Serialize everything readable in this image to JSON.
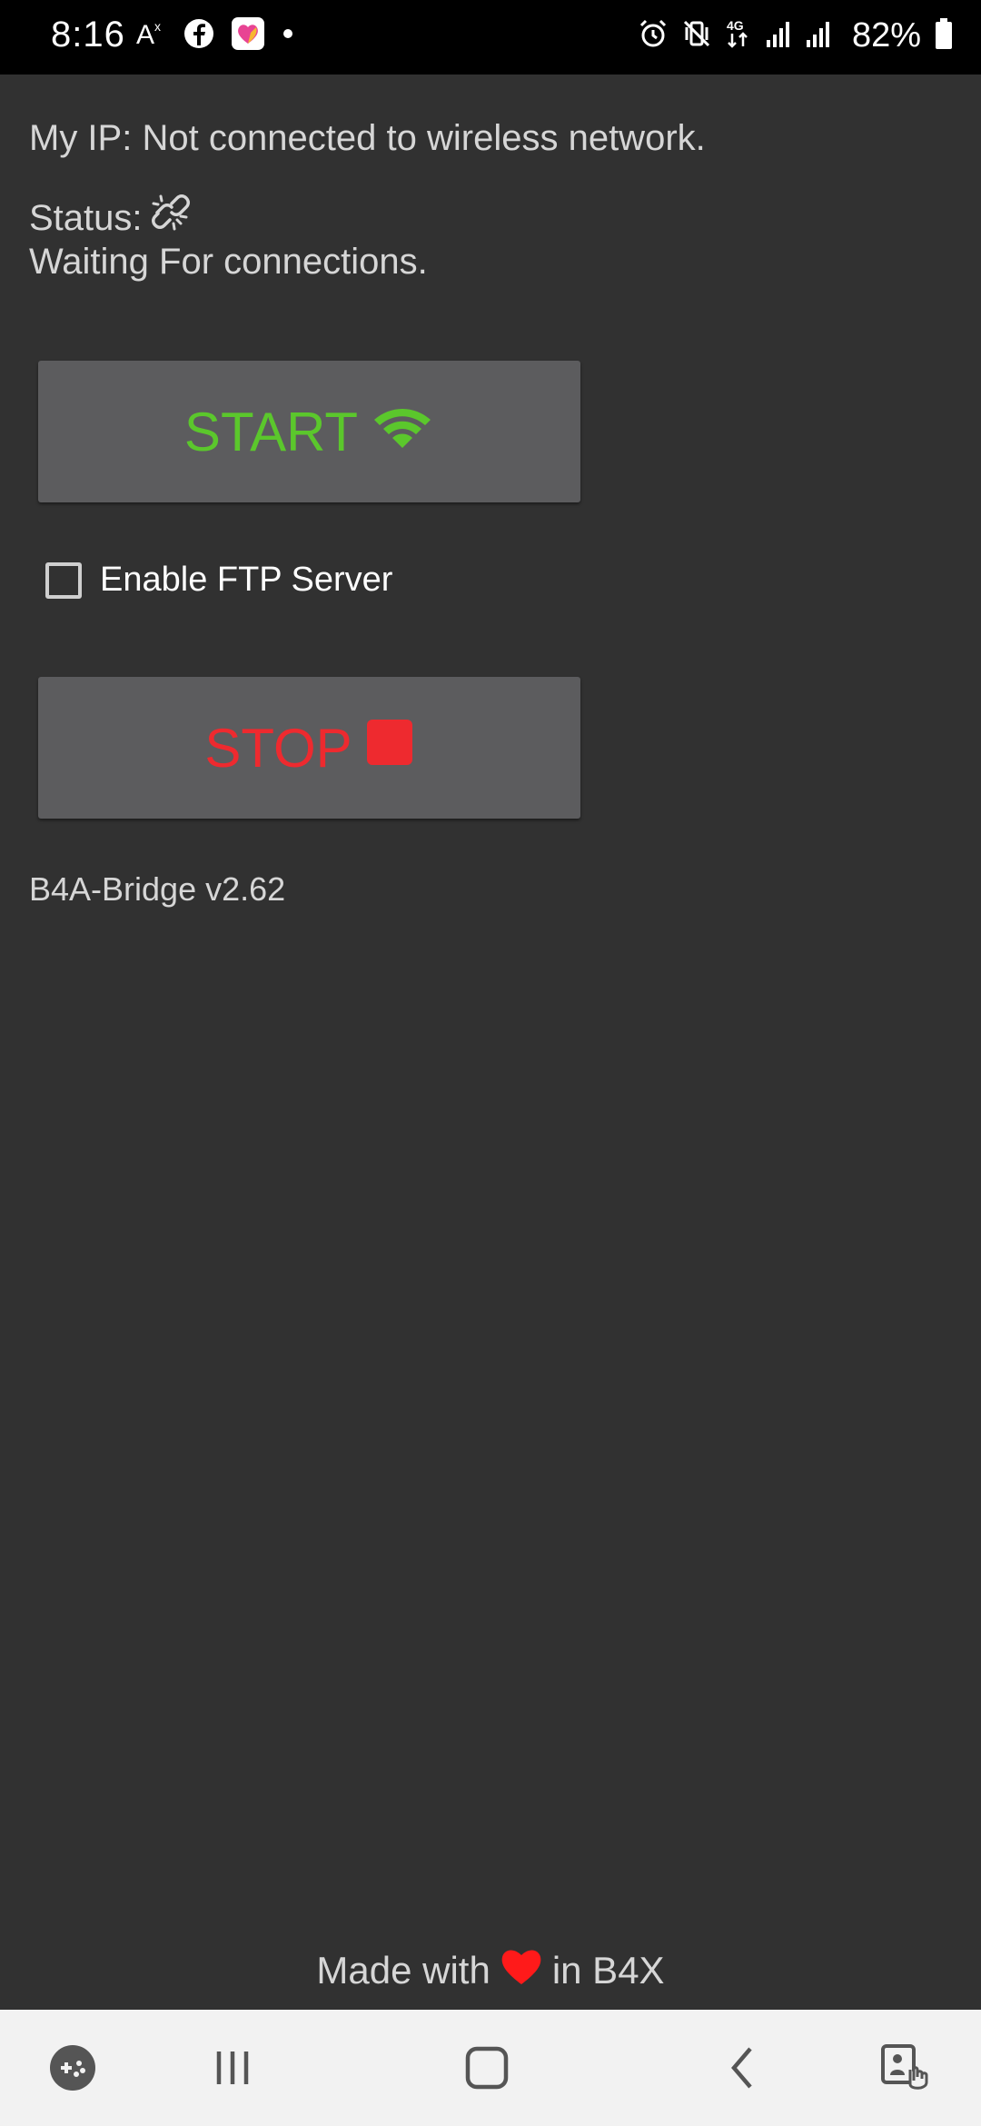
{
  "status_bar": {
    "time": "8:16",
    "battery_percent": "82%",
    "network_type": "4G",
    "left_icons": [
      "translate-icon",
      "facebook-icon",
      "health-app-icon",
      "dot-icon"
    ],
    "right_icons": [
      "alarm-icon",
      "vibrate-mute-icon",
      "4g-data-icon",
      "signal-icon",
      "signal-icon",
      "battery-icon"
    ]
  },
  "app": {
    "ip_text": "My IP: Not connected to wireless network.",
    "status_label": "Status:",
    "status_icon": "broken-link-icon",
    "status_message": "Waiting For connections.",
    "start_button": {
      "label": "START",
      "icon": "wifi-icon",
      "color": "#5bc72c"
    },
    "ftp_checkbox": {
      "label": "Enable FTP Server",
      "checked": false
    },
    "stop_button": {
      "label": "STOP",
      "icon": "stop-square-icon",
      "color": "#ee2a2f"
    },
    "version": "B4A-Bridge v2.62",
    "footer": {
      "prefix": "Made with",
      "icon": "heart-icon",
      "suffix": "in B4X"
    }
  },
  "nav_bar": {
    "items": [
      "game-launcher-icon",
      "recents-icon",
      "home-icon",
      "back-icon",
      "accessibility-icon"
    ]
  },
  "colors": {
    "background": "#313131",
    "button_bg": "#5c5c5e",
    "start_green": "#5bc72c",
    "stop_red": "#ee2a2f",
    "heart_red": "#ff1a1a",
    "nav_bg": "#f2f2f2"
  }
}
